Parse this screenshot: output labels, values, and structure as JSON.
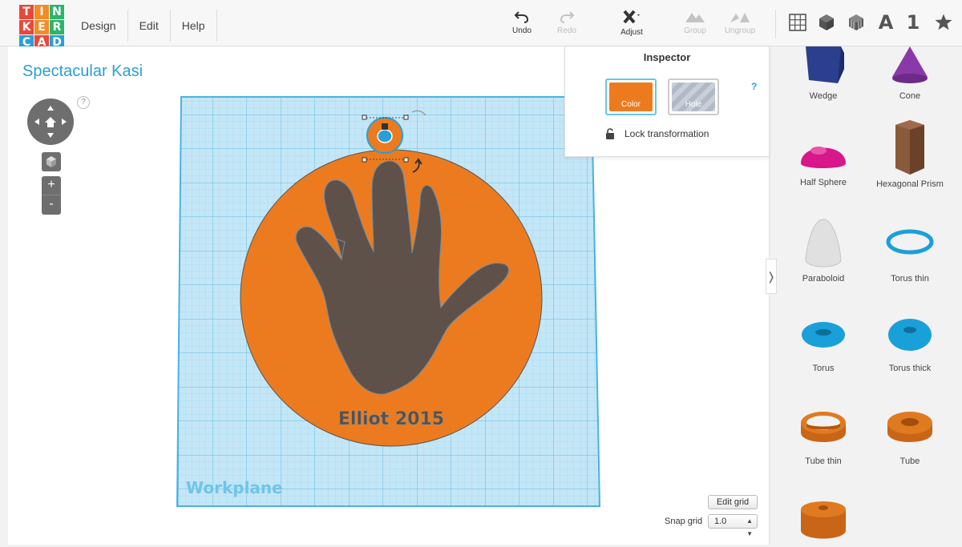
{
  "app": {
    "logo_letters": [
      "T",
      "I",
      "N",
      "K",
      "E",
      "R",
      "C",
      "A",
      "D"
    ],
    "logo_colors": [
      "#e8483c",
      "#f28c28",
      "#2db46a",
      "#e8483c",
      "#f28c28",
      "#2db46a",
      "#2a9fd6",
      "#e8483c",
      "#2a9fd6"
    ]
  },
  "menu": {
    "items": [
      "Design",
      "Edit",
      "Help"
    ]
  },
  "toolbar": {
    "undo_label": "Undo",
    "redo_label": "Redo",
    "adjust_label": "Adjust",
    "group_label": "Group",
    "ungroup_label": "Ungroup"
  },
  "views": {
    "text_label": "A",
    "number_label": "1"
  },
  "design": {
    "title": "Spectacular Kasi",
    "help": "?",
    "model_text": "Elliot 2015",
    "workplane_label": "Workplane"
  },
  "grid": {
    "edit_label": "Edit grid",
    "snap_label": "Snap grid",
    "snap_value": "1.0"
  },
  "inspector": {
    "title": "Inspector",
    "color_label": "Color",
    "hole_label": "Hole",
    "help": "?",
    "lock_label": "Lock transformation",
    "color_value": "#ec7b1f"
  },
  "shapes": [
    {
      "name": "Wedge",
      "icon": "wedge-icon",
      "color": "#2b3f8f"
    },
    {
      "name": "Cone",
      "icon": "cone-icon",
      "color": "#8a3aa8"
    },
    {
      "name": "Half Sphere",
      "icon": "half-sphere-icon",
      "color": "#d6188a"
    },
    {
      "name": "Hexagonal Prism",
      "icon": "hexagonal-prism-icon",
      "color": "#8a5a3c"
    },
    {
      "name": "Paraboloid",
      "icon": "paraboloid-icon",
      "color": "#e0e0e0"
    },
    {
      "name": "Torus thin",
      "icon": "torus-thin-icon",
      "color": "#1aa0d8"
    },
    {
      "name": "Torus",
      "icon": "torus-icon",
      "color": "#1aa0d8"
    },
    {
      "name": "Torus thick",
      "icon": "torus-thick-icon",
      "color": "#1aa0d8"
    },
    {
      "name": "Tube thin",
      "icon": "tube-thin-icon",
      "color": "#e07a20"
    },
    {
      "name": "Tube",
      "icon": "tube-icon",
      "color": "#e07a20"
    },
    {
      "name": "",
      "icon": "ring-icon",
      "color": "#e07a20"
    }
  ]
}
